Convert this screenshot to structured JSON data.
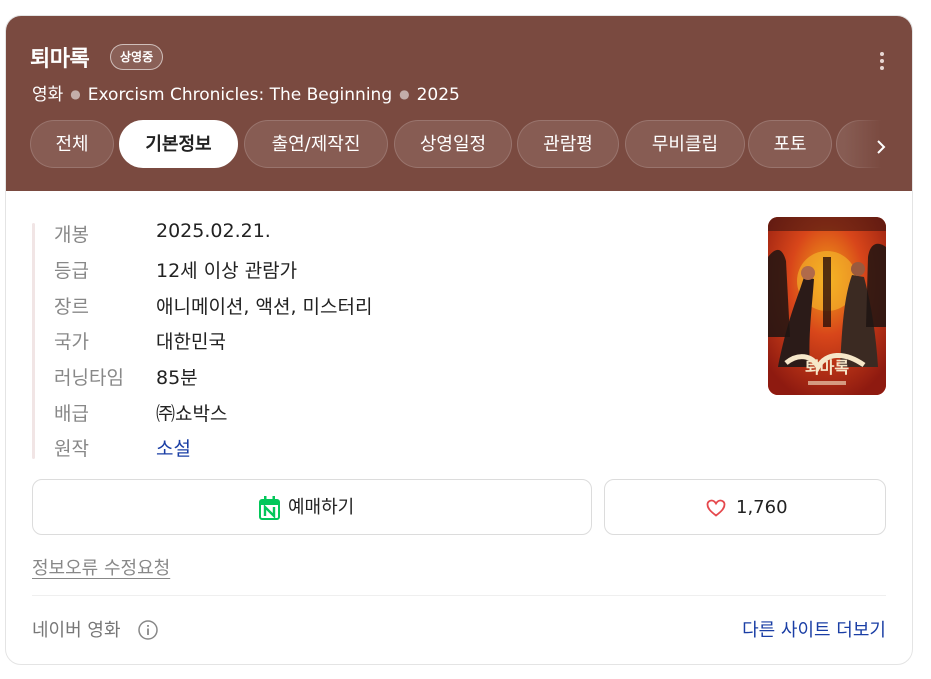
{
  "header": {
    "title": "퇴마록",
    "badge": "상영중",
    "category": "영화",
    "english_title": "Exorcism Chronicles: The Beginning",
    "year": "2025",
    "background_color": "#7a4a40"
  },
  "tabs": [
    {
      "label": "전체",
      "active": false
    },
    {
      "label": "기본정보",
      "active": true
    },
    {
      "label": "출연/제작진",
      "active": false
    },
    {
      "label": "상영일정",
      "active": false
    },
    {
      "label": "관람평",
      "active": false
    },
    {
      "label": "무비클립",
      "active": false
    },
    {
      "label": "포토",
      "active": false
    }
  ],
  "info": [
    {
      "key": "개봉",
      "value": "2025.02.21."
    },
    {
      "key": "등급",
      "value": "12세 이상 관람가"
    },
    {
      "key": "장르",
      "value": "애니메이션, 액션, 미스터리"
    },
    {
      "key": "국가",
      "value": "대한민국"
    },
    {
      "key": "러닝타임",
      "value": "85분"
    },
    {
      "key": "배급",
      "value": "㈜쇼박스"
    },
    {
      "key": "원작",
      "value": "소설"
    }
  ],
  "poster": {
    "title_text": "퇴마록"
  },
  "actions": {
    "reserve_label": "예매하기",
    "reserve_icon": "naver-calendar-icon",
    "like_count": "1,760",
    "like_icon": "heart-icon"
  },
  "footer": {
    "report_label": "정보오류 수정요청",
    "source_label": "네이버 영화",
    "more_sites_label": "다른 사이트 더보기"
  },
  "colors": {
    "link": "#1a3ea5",
    "naver_green": "#03c75a",
    "heart": "#e5484d"
  }
}
